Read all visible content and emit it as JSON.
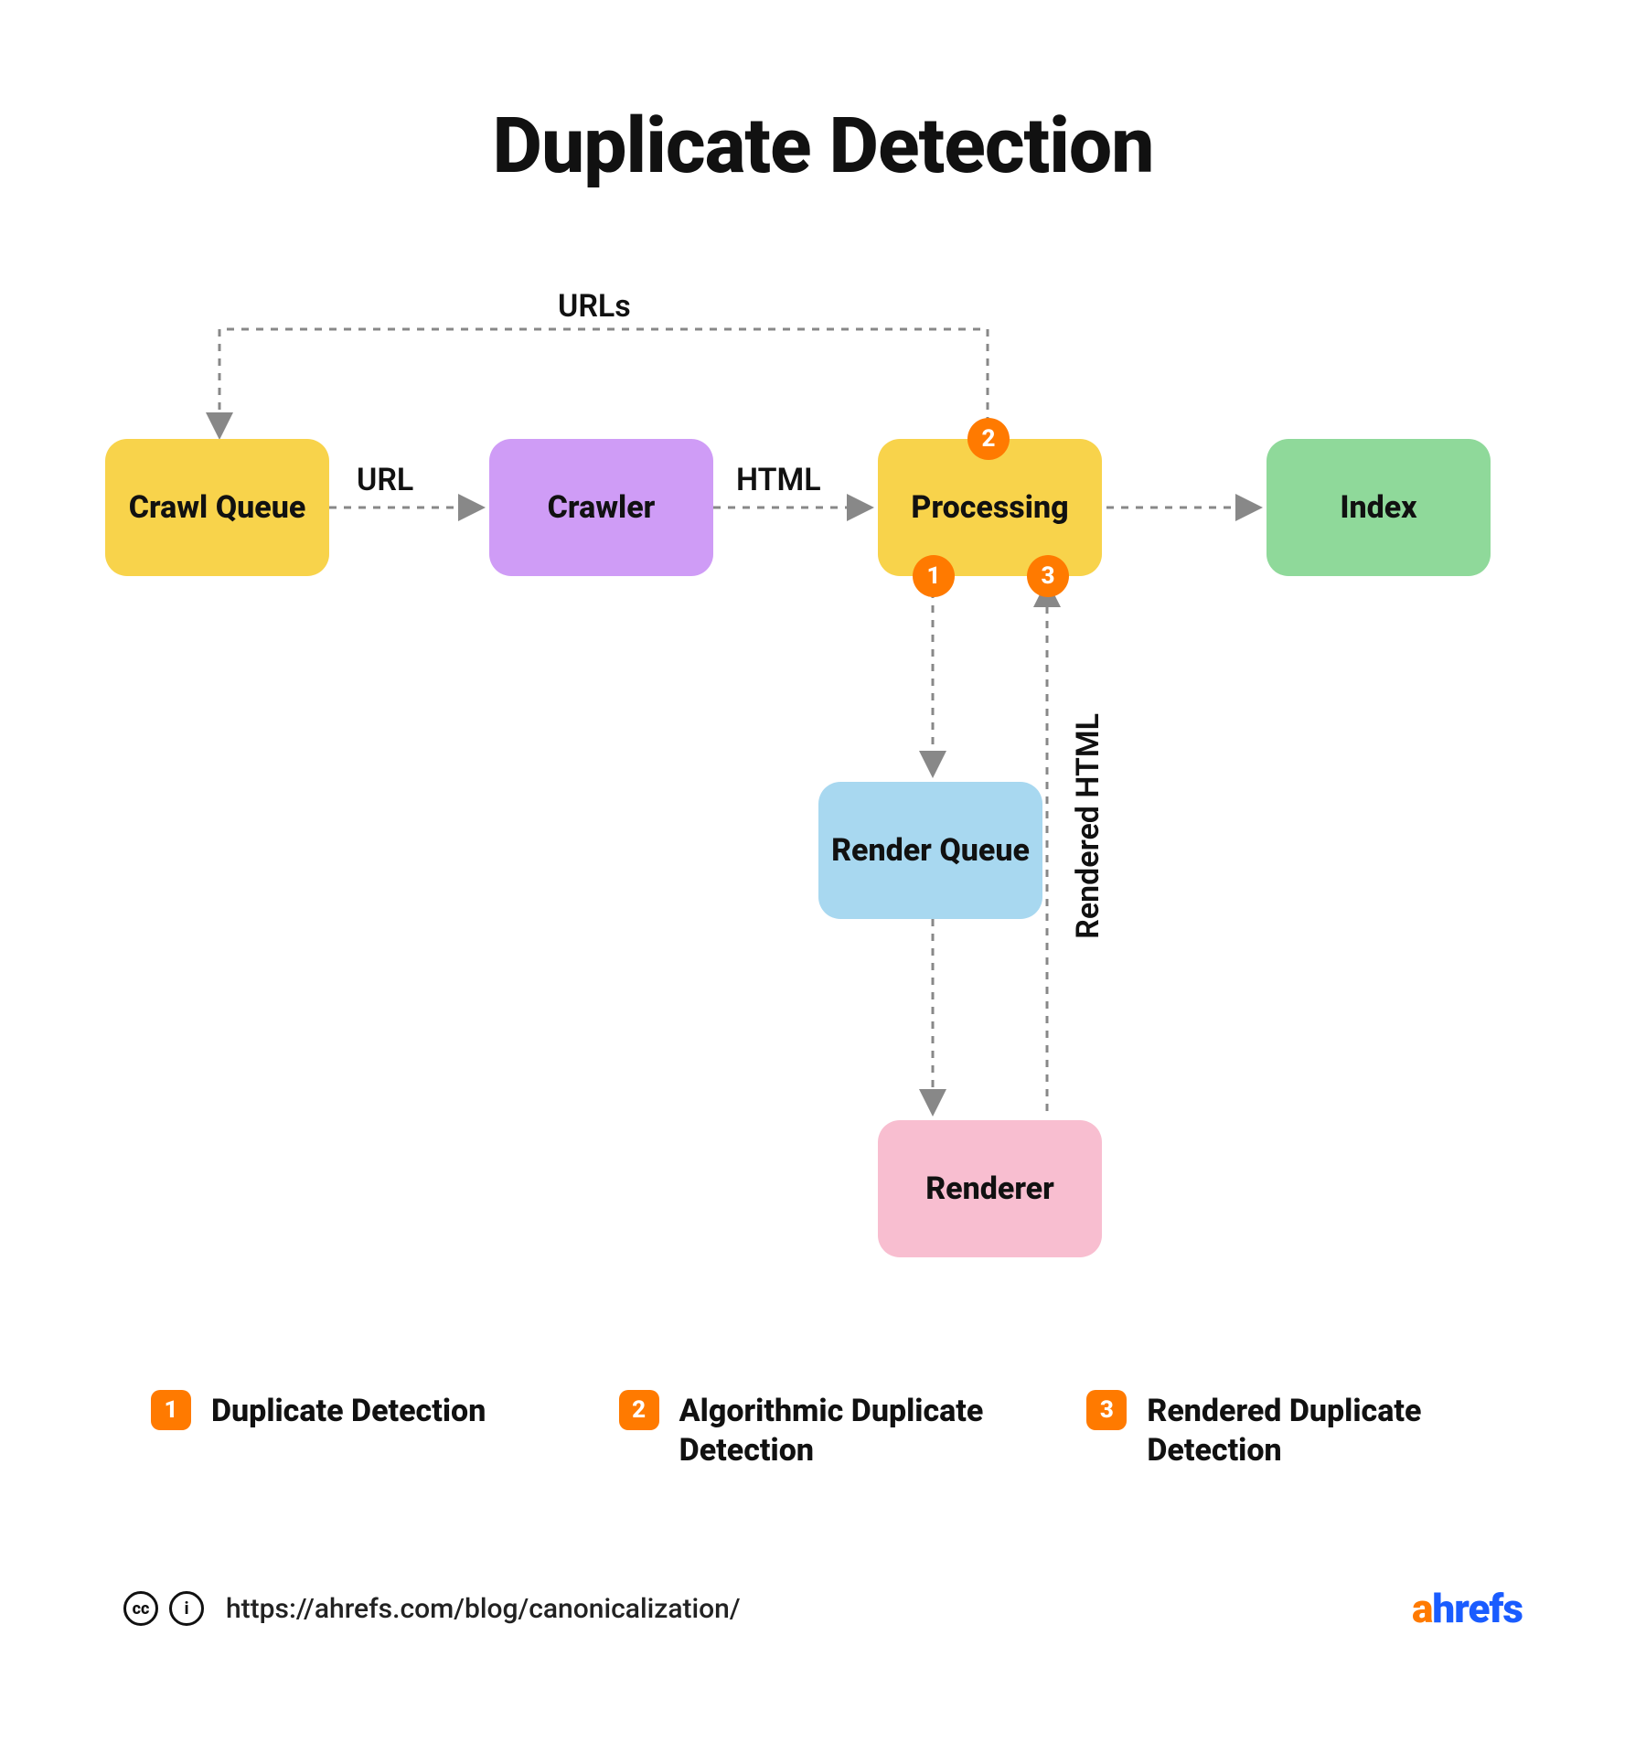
{
  "title": "Duplicate Detection",
  "nodes": {
    "crawl_queue": "Crawl Queue",
    "crawler": "Crawler",
    "processing": "Processing",
    "index": "Index",
    "render_queue": "Render Queue",
    "renderer": "Renderer"
  },
  "edges": {
    "urls_back": "URLs",
    "url": "URL",
    "html": "HTML",
    "rendered_html": "Rendered HTML"
  },
  "badges": {
    "b1": "1",
    "b2": "2",
    "b3": "3"
  },
  "legend": [
    {
      "num": "1",
      "text": "Duplicate Detection"
    },
    {
      "num": "2",
      "text": "Algorithmic Duplicate Detection"
    },
    {
      "num": "3",
      "text": "Rendered Duplicate Detection"
    }
  ],
  "footer": {
    "url": "https://ahrefs.com/blog/canonicalization/",
    "brand_part1": "a",
    "brand_part2": "hrefs"
  },
  "colors": {
    "yellow": "#f8d34b",
    "purple": "#cf9cf6",
    "green": "#8fd99a",
    "blue": "#a8d8f0",
    "pink": "#f8bed0",
    "orange": "#ff7a00",
    "brand_blue": "#1a5cff"
  }
}
